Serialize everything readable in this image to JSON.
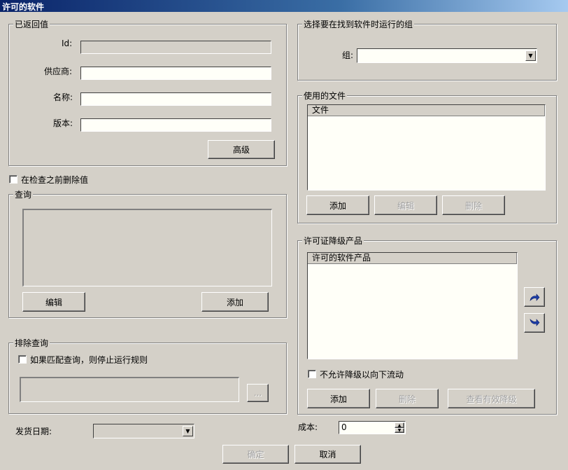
{
  "window": {
    "title": "许可的软件"
  },
  "return_values": {
    "legend": "已返回值",
    "id_label": "Id:",
    "id_value": "",
    "vendor_label": "供应商:",
    "vendor_value": "",
    "name_label": "名称:",
    "name_value": "",
    "version_label": "版本:",
    "version_value": "",
    "advanced_button": "高级"
  },
  "delete_before_check": {
    "label": "在检查之前删除值",
    "checked": false
  },
  "query": {
    "legend": "查询",
    "text": "",
    "edit_button": "编辑",
    "add_button": "添加"
  },
  "exclude_query": {
    "legend": "排除查询",
    "stop_label": "如果匹配查询，则停止运行规则",
    "stop_checked": false,
    "text": "",
    "browse_button": "..."
  },
  "ship_date": {
    "label": "发货日期:",
    "value": ""
  },
  "group_select": {
    "legend": "选择要在找到软件时运行的组",
    "group_label": "组:",
    "group_value": ""
  },
  "used_files": {
    "legend": "使用的文件",
    "column_header": "文件",
    "rows": [],
    "add_button": "添加",
    "edit_button": "编辑",
    "delete_button": "删除"
  },
  "downgrade": {
    "legend": "许可证降级产品",
    "column_header": "许可的软件产品",
    "rows": [],
    "move_up_icon": "arrow-up-icon",
    "move_down_icon": "arrow-down-icon",
    "no_flow_label": "不允许降级以向下流动",
    "no_flow_checked": false,
    "add_button": "添加",
    "delete_button": "删除",
    "view_button": "查看有效降级"
  },
  "cost": {
    "label": "成本:",
    "value": "0"
  },
  "footer": {
    "ok_button": "确定",
    "cancel_button": "取消"
  }
}
